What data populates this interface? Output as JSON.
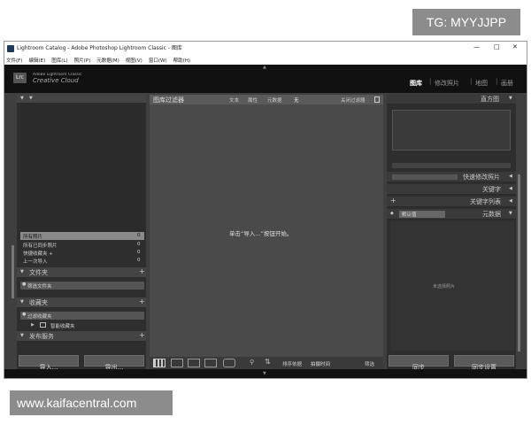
{
  "watermarks": {
    "top_right": "TG: MYYJJPP",
    "bottom_left": "www.kaifacentral.com"
  },
  "window": {
    "title": "Lightroom Catalog - Adobe Photoshop Lightroom Classic - 图库",
    "controls": {
      "minimize": "—",
      "maximize": "□",
      "close": "✕"
    }
  },
  "menu": [
    "文件(F)",
    "编辑(E)",
    "图库(L)",
    "照片(P)",
    "元数据(M)",
    "视图(V)",
    "窗口(W)",
    "帮助(H)"
  ],
  "identity": {
    "logo": "Lrc",
    "line1": "Adobe Lightroom Classic",
    "line2": "Creative Cloud"
  },
  "modules": [
    "图库",
    "修改照片",
    "地图",
    "画册"
  ],
  "left_panel": {
    "catalog_items": [
      {
        "label": "所有照片",
        "count": "0"
      },
      {
        "label": "所有已同步照片",
        "count": "0"
      },
      {
        "label": "快捷收藏夹 +",
        "count": "0"
      },
      {
        "label": "上一次导入",
        "count": "0"
      }
    ],
    "folders_header": "文件夹",
    "folders_filter": "筛选文件夹",
    "collections_header": "收藏夹",
    "collections_filter": "过滤收藏夹",
    "smart_collections": "智能收藏夹",
    "publish_header": "发布服务",
    "import_button": "导入...",
    "export_button": "导出..."
  },
  "filter_bar": {
    "title": "图库过滤器",
    "tabs": [
      "文本",
      "属性",
      "元数据",
      "无"
    ],
    "filter_off": "关闭过滤器"
  },
  "grid": {
    "empty_message": "单击“导入...”按钮开始。"
  },
  "toolbar": {
    "sort_label": "排序依据",
    "sort_value": "拍摄时间",
    "filter_label": "筛选"
  },
  "right_panel": {
    "histogram": "直方图",
    "quick_develop": "快速修改照片",
    "keywording": "关键字",
    "keyword_list": "关键字列表",
    "metadata": "元数据",
    "metadata_preset": "默认值",
    "no_photo": "未选择照片",
    "sync_button": "同步",
    "sync_settings_button": "同步设置"
  },
  "colors": {
    "window_bg": "#3f3f3f",
    "panel_bg": "#2e2e2e",
    "grid_bg": "#4a4a4a",
    "identity_bg": "#111111",
    "text_light": "#cfcfcf",
    "watermark_bg": "#8c8c8c"
  }
}
